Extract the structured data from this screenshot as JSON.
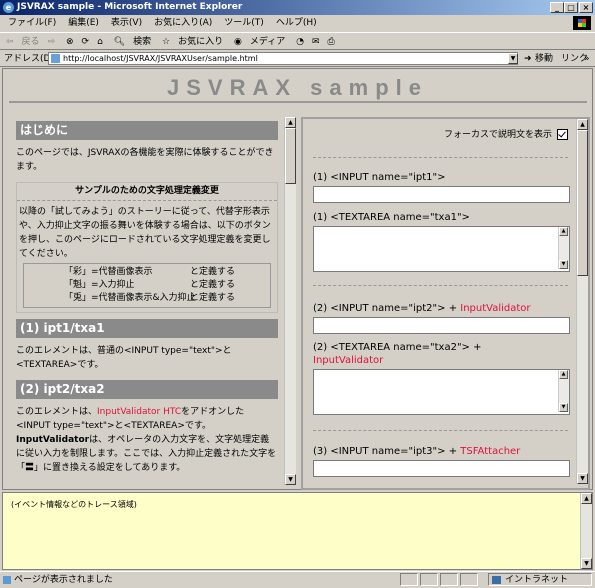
{
  "window": {
    "title": "JSVRAX sample - Microsoft Internet Explorer"
  },
  "menu": [
    "ファイル(F)",
    "編集(E)",
    "表示(V)",
    "お気に入り(A)",
    "ツール(T)",
    "ヘルプ(H)"
  ],
  "toolbar": {
    "back": "戻る",
    "search": "検索",
    "favorites": "お気に入り",
    "media": "メディア"
  },
  "address": {
    "label": "アドレス(D)",
    "url": "http://localhost/JSVRAX/JSVRAXUser/sample.html",
    "go": "移動",
    "links": "リンク"
  },
  "page": {
    "heading": "JSVRAX sample"
  },
  "left": {
    "s_intro": "はじめに",
    "p_intro": "このページでは、JSVRAXの各機能を実際に体験することができます。",
    "box_title": "サンプルのための文字処理定義変更",
    "box_body": "以降の「試してみよう」のストーリーに従って、代替字形表示や、入力抑止文字の振る舞いを体験する場合は、以下のボタンを押し、このページにロードされている文字処理定義を変更してください。",
    "defs": [
      {
        "name": "「彩」=代替画像表示",
        "suffix": "と定義する"
      },
      {
        "name": "「魁」=入力抑止",
        "suffix": "と定義する"
      },
      {
        "name": "「兎」=代替画像表示&入力抑止",
        "suffix": "と定義する"
      }
    ],
    "s1": "(1) ipt1/txa1",
    "p1": "このエレメントは、普通の<INPUT type=\"text\">と<TEXTAREA>です。",
    "s2": "(2) ipt2/txa2",
    "p2_pre": "このエレメントは、",
    "p2_red": "InputValidator HTC",
    "p2_mid": "をアドオンした<INPUT type=\"text\">と<TEXTAREA>です。",
    "p2_bold": "InputValidator",
    "p2_post": "は、オペレータの入力文字を、文字処理定義に従い入力を制限します。ここでは、入力抑止定義された文字を「〓」に置き換える設定をしてあります。"
  },
  "right": {
    "focus_label": "フォーカスで説明文を表示",
    "l1": "(1) <INPUT name=\"ipt1\">",
    "l2": "(1) <TEXTAREA name=\"txa1\">",
    "l3": "(2) <INPUT name=\"ipt2\"> + ",
    "l3_red": "InputValidator",
    "l4": "(2) <TEXTAREA name=\"txa2\"> + ",
    "l4_red": "InputValidator",
    "l5": "(3) <INPUT name=\"ipt3\"> + ",
    "l5_red": "TSFAttacher"
  },
  "trace": {
    "text": "(イベント情報などのトレース領域)"
  },
  "status": {
    "text": "ページが表示されました",
    "zone": "イントラネット"
  },
  "colors": {
    "accent_red": "#e0103a",
    "section_bg": "#8a8a8a",
    "trace_bg": "#fefec8"
  }
}
